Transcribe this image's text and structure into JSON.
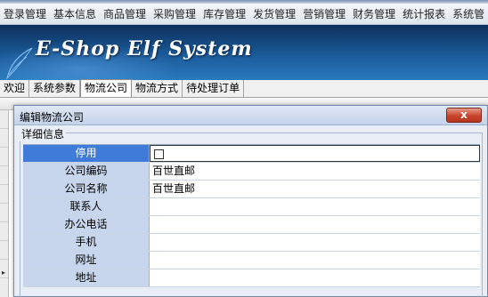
{
  "menu": {
    "items": [
      "登录管理",
      "基本信息",
      "商品管理",
      "采购管理",
      "库存管理",
      "发货管理",
      "营销管理",
      "财务管理",
      "统计报表",
      "系统管"
    ]
  },
  "banner": {
    "logo_text": "E-Shop Elf System"
  },
  "tabs": [
    {
      "label": "欢迎"
    },
    {
      "label": "系统参数"
    },
    {
      "label": "物流公司"
    },
    {
      "label": "物流方式"
    },
    {
      "label": "待处理订单"
    }
  ],
  "dialog": {
    "title": "编辑物流公司",
    "close_label": "x",
    "section_title": "详细信息",
    "fields": [
      {
        "label": "停用",
        "value": ""
      },
      {
        "label": "公司编码",
        "value": "百世直邮"
      },
      {
        "label": "公司名称",
        "value": "百世直邮"
      },
      {
        "label": "联系人",
        "value": ""
      },
      {
        "label": "办公电话",
        "value": ""
      },
      {
        "label": "手机",
        "value": ""
      },
      {
        "label": "网址",
        "value": ""
      },
      {
        "label": "地址",
        "value": ""
      }
    ]
  },
  "grid": {
    "row_indicator": "▸"
  },
  "colors": {
    "accent": "#3f7bd8",
    "label_bg": "#c7d6ed",
    "banner": "#1b5b9a"
  }
}
